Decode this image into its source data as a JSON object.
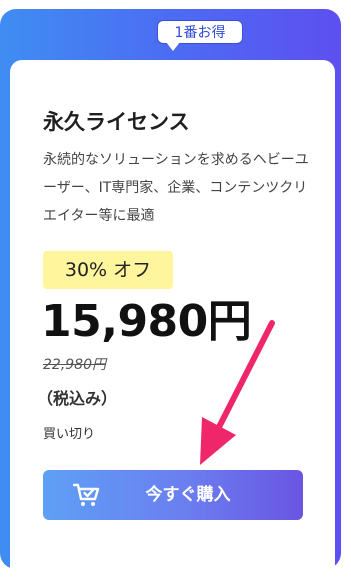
{
  "badge": {
    "text": "1番お得"
  },
  "plan": {
    "title": "永久ライセンス",
    "description": "永続的なソリューションを求めるヘビーユーザー、IT専門家、企業、コンテンツクリエイター等に最適"
  },
  "pricing": {
    "discount": "30% オフ",
    "price": "15,980円",
    "old_price": "22,980円",
    "tax_note": "（税込み）",
    "billing": "買い切り"
  },
  "cta": {
    "label": "今すぐ購入",
    "icon": "cart-check-icon"
  },
  "colors": {
    "accent": "#4c6cf3",
    "highlight": "#fff59d",
    "arrow": "#f0266a"
  }
}
